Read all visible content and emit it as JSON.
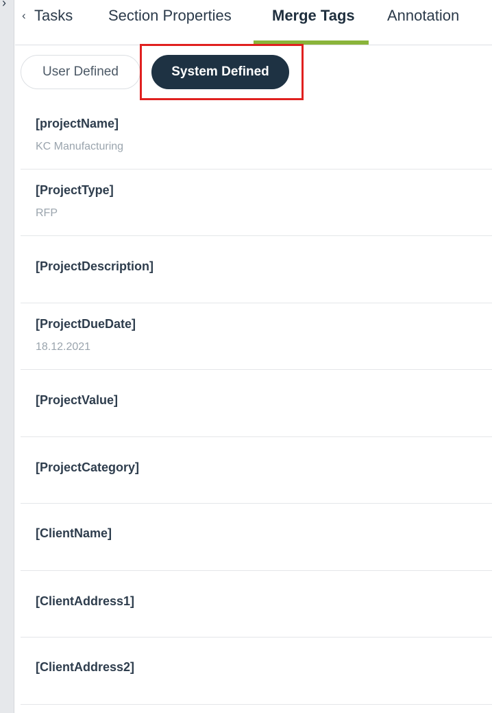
{
  "rail": {
    "chevron": "›"
  },
  "tabs": {
    "back_icon": "‹",
    "items": [
      {
        "label": "Tasks"
      },
      {
        "label": "Section Properties"
      },
      {
        "label": "Merge Tags"
      },
      {
        "label": "Annotation"
      }
    ],
    "active": "Merge Tags"
  },
  "toggle": {
    "user_label": "User Defined",
    "system_label": "System Defined",
    "selected": "System Defined"
  },
  "tags": [
    {
      "name": "[projectName]",
      "value": "KC Manufacturing"
    },
    {
      "name": "[ProjectType]",
      "value": "RFP"
    },
    {
      "name": "[ProjectDescription]",
      "value": ""
    },
    {
      "name": "[ProjectDueDate]",
      "value": "18.12.2021"
    },
    {
      "name": "[ProjectValue]",
      "value": ""
    },
    {
      "name": "[ProjectCategory]",
      "value": ""
    },
    {
      "name": "[ClientName]",
      "value": ""
    },
    {
      "name": "[ClientAddress1]",
      "value": ""
    },
    {
      "name": "[ClientAddress2]",
      "value": ""
    }
  ],
  "colors": {
    "accent_green": "#8ab43a",
    "selected_pill": "#1e3243",
    "highlight_red": "#e0201f"
  }
}
